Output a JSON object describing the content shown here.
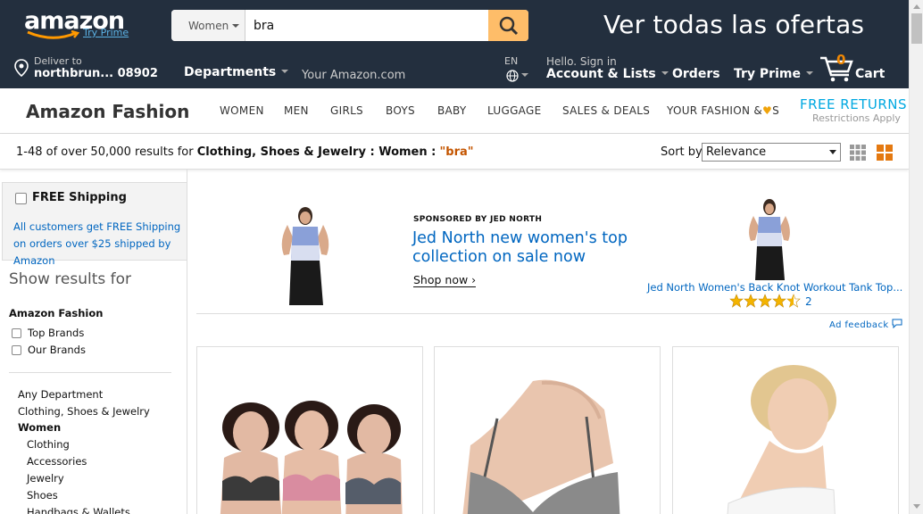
{
  "colors": {
    "nav_bg": "#232f3e",
    "search_button": "#febd69",
    "link_blue": "#0066c0",
    "query_orange": "#c45500",
    "cart_count": "#f08804",
    "free_returns": "#00a8e1"
  },
  "header": {
    "logo_text": "amazon",
    "logo_prime": "Try Prime",
    "search": {
      "category": "Women",
      "query": "bra"
    },
    "promo": "Ver todas las ofertas",
    "deliver": {
      "line1": "Deliver to",
      "line2": "northbrun... 08902"
    },
    "departments": "Departments",
    "your_amazon": "Your Amazon.com",
    "language": "EN",
    "account": {
      "line1": "Hello. Sign in",
      "line2": "Account & Lists"
    },
    "orders": "Orders",
    "try_prime": "Try Prime",
    "cart": {
      "count": "0",
      "label": "Cart"
    }
  },
  "subnav": {
    "title": "Amazon Fashion",
    "links": [
      "WOMEN",
      "MEN",
      "GIRLS",
      "BOYS",
      "BABY",
      "LUGGAGE",
      "SALES & DEALS"
    ],
    "your_fashion_pre": "YOUR FASHION &",
    "your_fashion_post": "S",
    "free_returns": "FREE RETURNS",
    "restrictions": "Restrictions Apply"
  },
  "results": {
    "count_text": "1-48 of over 50,000 results for",
    "category_path": "Clothing, Shoes & Jewelry : Women :",
    "query": "\"bra\"",
    "sort_label": "Sort by",
    "sort_value": "Relevance"
  },
  "sidebar": {
    "free_shipping": "FREE Shipping",
    "free_shipping_desc": "All customers get FREE Shipping on orders over $25 shipped by Amazon",
    "show_results": "Show results for",
    "amazon_fashion": "Amazon Fashion",
    "brand_filters": [
      "Top Brands",
      "Our Brands"
    ],
    "departments": [
      {
        "label": "Any Department",
        "bold": false,
        "indent": false
      },
      {
        "label": "Clothing, Shoes & Jewelry",
        "bold": false,
        "indent": false
      },
      {
        "label": "Women",
        "bold": true,
        "indent": false
      },
      {
        "label": "Clothing",
        "bold": false,
        "indent": true
      },
      {
        "label": "Accessories",
        "bold": false,
        "indent": true
      },
      {
        "label": "Jewelry",
        "bold": false,
        "indent": true
      },
      {
        "label": "Shoes",
        "bold": false,
        "indent": true
      },
      {
        "label": "Handbags & Wallets",
        "bold": false,
        "indent": true
      }
    ]
  },
  "ad": {
    "sponsored": "SPONSORED BY JED NORTH",
    "headline": "Jed North new women's top collection on sale now",
    "shop_now": "Shop now ›",
    "product_title": "Jed North Women's Back Knot Workout Tank Top...",
    "rating": 4.5,
    "review_count": "2",
    "ad_feedback": "Ad feedback"
  },
  "products": [
    {
      "name": "product-card-1"
    },
    {
      "name": "product-card-2"
    },
    {
      "name": "product-card-3"
    }
  ]
}
